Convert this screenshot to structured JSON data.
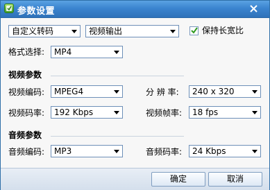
{
  "window": {
    "title": "参数设置",
    "close_icon": "close-icon"
  },
  "top": {
    "preset_select": "自定义转码",
    "output_select": "视频输出",
    "keep_ratio_label": "保持长宽比",
    "keep_ratio_checked": true,
    "format_label": "格式选择:",
    "format_value": "MP4"
  },
  "video": {
    "section_title": "视频参数",
    "codec_label": "视频编码:",
    "codec_value": "MPEG4",
    "resolution_label": "分 辨 率:",
    "resolution_value": "240 x 320",
    "bitrate_label": "视频码率:",
    "bitrate_value": "192 Kbps",
    "framerate_label": "视频帧率:",
    "framerate_value": "18 fps"
  },
  "audio": {
    "section_title": "音频参数",
    "codec_label": "音频编码:",
    "codec_value": "MP3",
    "bitrate_label": "音频码率:",
    "bitrate_value": "24 Kbps"
  },
  "footer": {
    "ok_label": "确定",
    "cancel_label": "取消"
  },
  "colors": {
    "titlebar": "#3b84cf",
    "border": "#2f6fa8",
    "checkmark": "#2f9a1f"
  }
}
